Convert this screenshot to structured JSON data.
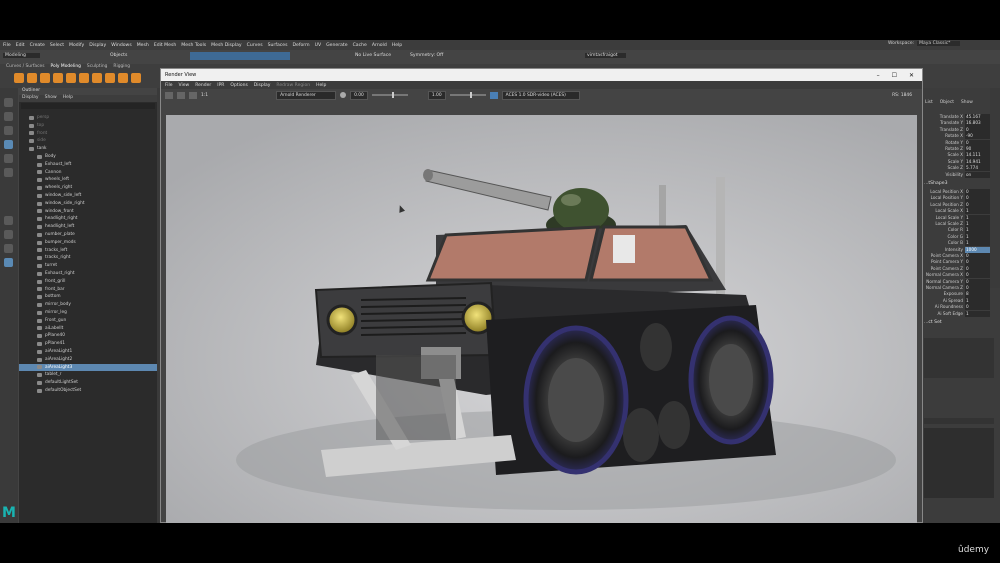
{
  "menubar": {
    "items": [
      "File",
      "Edit",
      "Create",
      "Select",
      "Modify",
      "Display",
      "Windows",
      "Mesh",
      "Edit Mesh",
      "Mesh Tools",
      "Mesh Display",
      "Curves",
      "Surfaces",
      "Deform",
      "UV",
      "Generate",
      "Cache",
      "Arnold",
      "Help"
    ],
    "workspace_label": "Workspace:",
    "workspace_value": "Maya Classic*"
  },
  "statusline": {
    "mode": "Modeling",
    "objects": "Objects",
    "live_surface": "No Live Surface",
    "symmetry": "Symmetry: Off",
    "user": "vimtasfraigot"
  },
  "shelf": {
    "tabs": [
      "Curves / Surfaces",
      "Poly Modeling",
      "Sculpting",
      "Rigging"
    ]
  },
  "outliner": {
    "title": "Outliner",
    "menu": [
      "Display",
      "Show",
      "Help"
    ],
    "items": [
      {
        "label": "persp",
        "dim": true
      },
      {
        "label": "top",
        "dim": true
      },
      {
        "label": "front",
        "dim": true
      },
      {
        "label": "side",
        "dim": true
      },
      {
        "label": "tank"
      },
      {
        "label": "Body"
      },
      {
        "label": "Exhaust_left"
      },
      {
        "label": "Cannon"
      },
      {
        "label": "wheels_left"
      },
      {
        "label": "wheels_right"
      },
      {
        "label": "window_side_left"
      },
      {
        "label": "window_side_right"
      },
      {
        "label": "window_front"
      },
      {
        "label": "headlight_right"
      },
      {
        "label": "headlight_left"
      },
      {
        "label": "number_plate"
      },
      {
        "label": "bumper_mods"
      },
      {
        "label": "tracks_left"
      },
      {
        "label": "tracks_right"
      },
      {
        "label": "turret"
      },
      {
        "label": "Exhaust_right"
      },
      {
        "label": "front_grill"
      },
      {
        "label": "front_bar"
      },
      {
        "label": "bottom"
      },
      {
        "label": "mirror_body"
      },
      {
        "label": "mirror_leg"
      },
      {
        "label": "Front_gun"
      },
      {
        "label": "aiLabelIt"
      },
      {
        "label": "pPlane40"
      },
      {
        "label": "pPlane41"
      },
      {
        "label": "aiAreaLight1"
      },
      {
        "label": "aiAreaLight2"
      },
      {
        "label": "aiAreaLight3",
        "selected": true
      },
      {
        "label": "tablet_r"
      },
      {
        "label": "defaultLightSet"
      },
      {
        "label": "defaultObjectSet"
      }
    ]
  },
  "render_view": {
    "title": "Render View",
    "window_controls": [
      "–",
      "☐",
      "✕"
    ],
    "menu": [
      "File",
      "View",
      "Render",
      "IPR",
      "Options",
      "Display",
      "Redraw Region",
      "Help"
    ],
    "renderer": "Arnold Renderer",
    "exposure": "0.00",
    "gamma": "1.00",
    "view_transform": "ACES 1.0 SDR-video (ACES)",
    "stats": "RS: 1846",
    "ratio": "1:1"
  },
  "attributes": {
    "header": [
      "List",
      "Object",
      "Show"
    ],
    "channels": [
      {
        "name": "Translate X",
        "value": "45.167"
      },
      {
        "name": "Translate Y",
        "value": "16.803"
      },
      {
        "name": "Translate Z",
        "value": "0"
      },
      {
        "name": "Rotate X",
        "value": "-90"
      },
      {
        "name": "Rotate Y",
        "value": "0"
      },
      {
        "name": "Rotate Z",
        "value": "90"
      },
      {
        "name": "Scale X",
        "value": "14.111"
      },
      {
        "name": "Scale Y",
        "value": "14.941"
      },
      {
        "name": "Scale Z",
        "value": "5.774"
      },
      {
        "name": "Visibility",
        "value": "on"
      }
    ],
    "shape_title": "...tShape3",
    "shape_channels": [
      {
        "name": "Local Position X",
        "value": "0"
      },
      {
        "name": "Local Position Y",
        "value": "0"
      },
      {
        "name": "Local Position Z",
        "value": "0"
      },
      {
        "name": "Local Scale X",
        "value": "1"
      },
      {
        "name": "Local Scale Y",
        "value": "1"
      },
      {
        "name": "Local Scale Z",
        "value": "1"
      },
      {
        "name": "Color R",
        "value": "1"
      },
      {
        "name": "Color G",
        "value": "1"
      },
      {
        "name": "Color B",
        "value": "1"
      },
      {
        "name": "Intensity",
        "value": "1000",
        "highlight": true
      },
      {
        "name": "Point Camera X",
        "value": "0"
      },
      {
        "name": "Point Camera Y",
        "value": "0"
      },
      {
        "name": "Point Camera Z",
        "value": "0"
      },
      {
        "name": "Normal Camera X",
        "value": "0"
      },
      {
        "name": "Normal Camera Y",
        "value": "0"
      },
      {
        "name": "Normal Camera Z",
        "value": "0"
      },
      {
        "name": "Exposure",
        "value": "8"
      },
      {
        "name": "Ai Spread",
        "value": "1"
      },
      {
        "name": "Ai Roundness",
        "value": "0"
      },
      {
        "name": "Ai Soft Edge",
        "value": "1"
      }
    ],
    "section_label": "...ct Set"
  },
  "brand": {
    "maya_glyph": "M",
    "udemy": "ûdemy",
    "accent": "#19b3b1",
    "select_color": "#5d88b1"
  }
}
